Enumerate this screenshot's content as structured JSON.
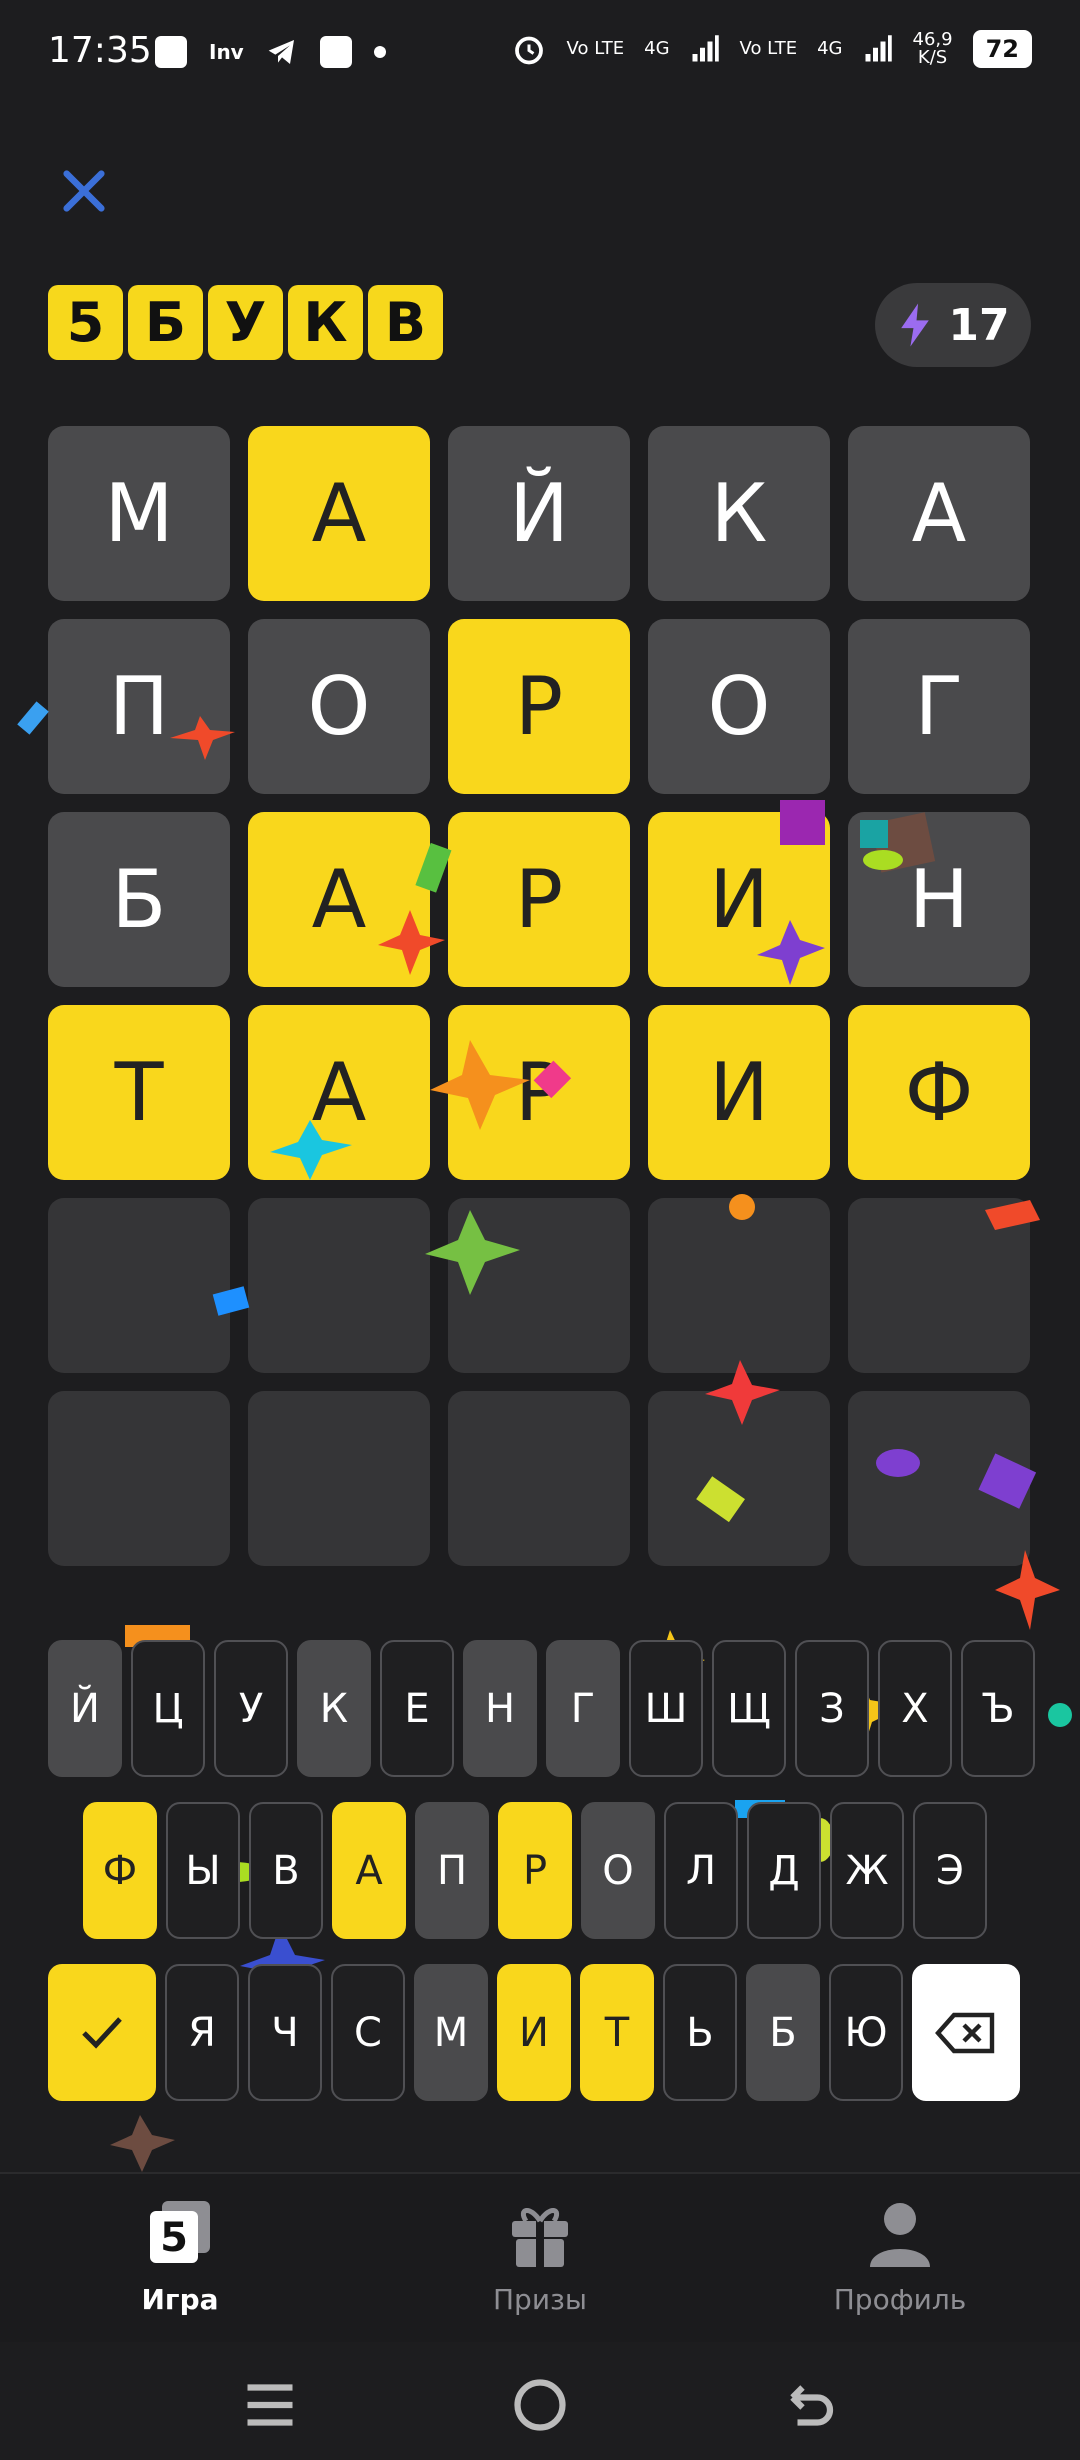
{
  "status_bar": {
    "time": "17:35",
    "app_label": "Inv",
    "net1": "Vo LTE",
    "net1_gen": "4G",
    "net2": "Vo LTE",
    "net2_gen": "4G",
    "speed": "46,9",
    "speed_unit": "K/S",
    "battery": "72"
  },
  "header": {
    "logo_letters": [
      "5",
      "Б",
      "У",
      "К",
      "В"
    ],
    "energy_count": "17"
  },
  "board": {
    "rows": [
      [
        {
          "l": "М",
          "s": "absent"
        },
        {
          "l": "А",
          "s": "present"
        },
        {
          "l": "Й",
          "s": "absent"
        },
        {
          "l": "К",
          "s": "absent"
        },
        {
          "l": "А",
          "s": "absent"
        }
      ],
      [
        {
          "l": "П",
          "s": "absent"
        },
        {
          "l": "О",
          "s": "absent"
        },
        {
          "l": "Р",
          "s": "present"
        },
        {
          "l": "О",
          "s": "absent"
        },
        {
          "l": "Г",
          "s": "absent"
        }
      ],
      [
        {
          "l": "Б",
          "s": "absent"
        },
        {
          "l": "А",
          "s": "present"
        },
        {
          "l": "Р",
          "s": "present"
        },
        {
          "l": "И",
          "s": "present"
        },
        {
          "l": "Н",
          "s": "absent"
        }
      ],
      [
        {
          "l": "Т",
          "s": "present"
        },
        {
          "l": "А",
          "s": "present"
        },
        {
          "l": "Р",
          "s": "present"
        },
        {
          "l": "И",
          "s": "present"
        },
        {
          "l": "Ф",
          "s": "present"
        }
      ],
      [
        {
          "l": "",
          "s": "empty"
        },
        {
          "l": "",
          "s": "empty"
        },
        {
          "l": "",
          "s": "empty"
        },
        {
          "l": "",
          "s": "empty"
        },
        {
          "l": "",
          "s": "empty"
        }
      ],
      [
        {
          "l": "",
          "s": "empty"
        },
        {
          "l": "",
          "s": "empty"
        },
        {
          "l": "",
          "s": "empty"
        },
        {
          "l": "",
          "s": "empty"
        },
        {
          "l": "",
          "s": "empty"
        }
      ]
    ]
  },
  "keyboard": {
    "row1": [
      {
        "k": "Й",
        "s": "used"
      },
      {
        "k": "Ц",
        "s": "unused"
      },
      {
        "k": "У",
        "s": "unused"
      },
      {
        "k": "К",
        "s": "used"
      },
      {
        "k": "Е",
        "s": "unused"
      },
      {
        "k": "Н",
        "s": "used"
      },
      {
        "k": "Г",
        "s": "used"
      },
      {
        "k": "Ш",
        "s": "unused"
      },
      {
        "k": "Щ",
        "s": "unused"
      },
      {
        "k": "З",
        "s": "unused"
      },
      {
        "k": "Х",
        "s": "unused"
      },
      {
        "k": "Ъ",
        "s": "unused"
      }
    ],
    "row2": [
      {
        "k": "Ф",
        "s": "present"
      },
      {
        "k": "Ы",
        "s": "unused"
      },
      {
        "k": "В",
        "s": "unused"
      },
      {
        "k": "А",
        "s": "present"
      },
      {
        "k": "П",
        "s": "used"
      },
      {
        "k": "Р",
        "s": "present"
      },
      {
        "k": "О",
        "s": "used"
      },
      {
        "k": "Л",
        "s": "unused"
      },
      {
        "k": "Д",
        "s": "unused"
      },
      {
        "k": "Ж",
        "s": "unused"
      },
      {
        "k": "Э",
        "s": "unused"
      }
    ],
    "row3": [
      {
        "k": "Я",
        "s": "unused"
      },
      {
        "k": "Ч",
        "s": "unused"
      },
      {
        "k": "С",
        "s": "unused"
      },
      {
        "k": "М",
        "s": "used"
      },
      {
        "k": "И",
        "s": "present"
      },
      {
        "k": "Т",
        "s": "present"
      },
      {
        "k": "Ь",
        "s": "unused"
      },
      {
        "k": "Б",
        "s": "used"
      },
      {
        "k": "Ю",
        "s": "unused"
      }
    ]
  },
  "nav": {
    "game_label": "Игра",
    "game_badge": "5",
    "prizes_label": "Призы",
    "profile_label": "Профиль"
  },
  "colors": {
    "present": "#f9d71c",
    "absent": "#4a4a4c",
    "empty": "#353537",
    "close_icon": "#3b6fd8",
    "energy_icon": "#9b6cf0"
  }
}
